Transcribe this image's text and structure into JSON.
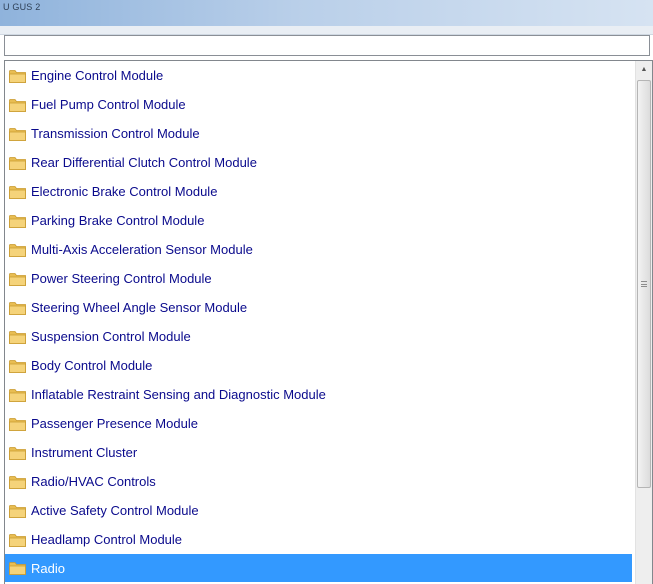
{
  "window": {
    "title": "U GUS 2"
  },
  "search": {
    "value": "",
    "placeholder": ""
  },
  "list": {
    "items": [
      {
        "label": "Engine Control Module",
        "icon": "folder-icon",
        "selected": false
      },
      {
        "label": "Fuel Pump Control Module",
        "icon": "folder-icon",
        "selected": false
      },
      {
        "label": "Transmission Control Module",
        "icon": "folder-icon",
        "selected": false
      },
      {
        "label": "Rear Differential Clutch Control Module",
        "icon": "folder-icon",
        "selected": false
      },
      {
        "label": "Electronic Brake Control Module",
        "icon": "folder-icon",
        "selected": false
      },
      {
        "label": "Parking Brake Control Module",
        "icon": "folder-icon",
        "selected": false
      },
      {
        "label": "Multi-Axis Acceleration Sensor Module",
        "icon": "folder-icon",
        "selected": false
      },
      {
        "label": "Power Steering Control Module",
        "icon": "folder-icon",
        "selected": false
      },
      {
        "label": "Steering Wheel Angle Sensor Module",
        "icon": "folder-icon",
        "selected": false
      },
      {
        "label": "Suspension Control Module",
        "icon": "folder-icon",
        "selected": false
      },
      {
        "label": "Body Control Module",
        "icon": "folder-icon",
        "selected": false
      },
      {
        "label": "Inflatable Restraint Sensing and Diagnostic Module",
        "icon": "folder-icon",
        "selected": false
      },
      {
        "label": "Passenger Presence Module",
        "icon": "folder-icon",
        "selected": false
      },
      {
        "label": "Instrument Cluster",
        "icon": "folder-icon",
        "selected": false
      },
      {
        "label": "Radio/HVAC Controls",
        "icon": "folder-icon",
        "selected": false
      },
      {
        "label": "Active Safety Control Module",
        "icon": "folder-icon",
        "selected": false
      },
      {
        "label": "Headlamp Control Module",
        "icon": "folder-icon",
        "selected": false
      },
      {
        "label": "Radio",
        "icon": "folder-icon",
        "selected": true
      }
    ]
  },
  "scrollbar": {
    "up_arrow": "▲",
    "up_icon": "chevron-up-icon",
    "grip_icon": "grip-icon"
  },
  "colors": {
    "selection": "#3399ff",
    "item_text": "#0a0a8c",
    "folder": "#f5d37a"
  }
}
